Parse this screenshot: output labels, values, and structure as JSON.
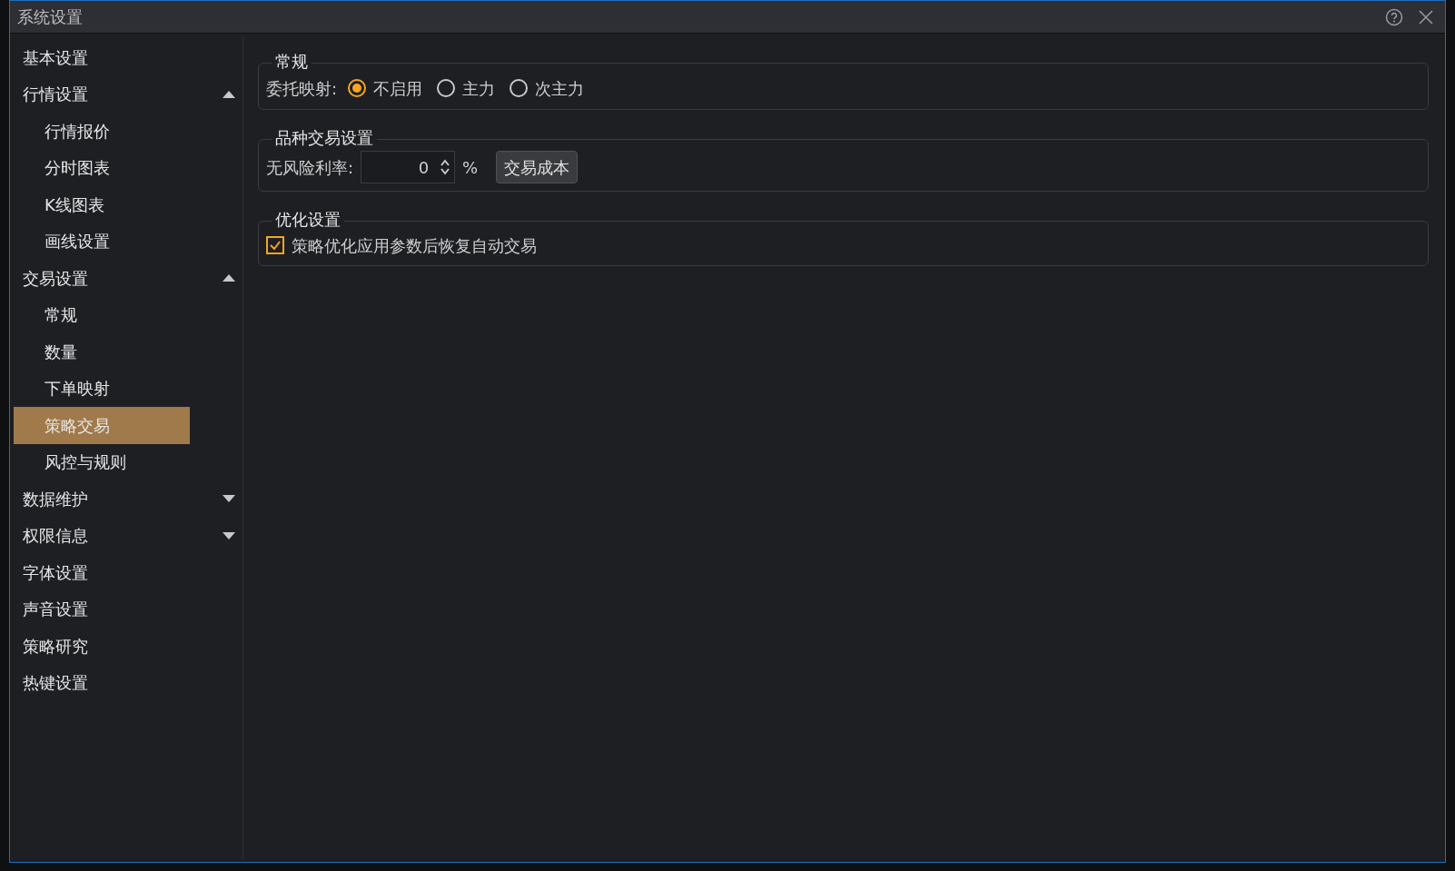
{
  "window": {
    "title": "系统设置"
  },
  "sidebar": {
    "items": [
      {
        "label": "基本设置",
        "selected": false
      },
      {
        "label": "行情设置",
        "selected": false,
        "expanded": true,
        "children": [
          {
            "label": "行情报价",
            "selected": false
          },
          {
            "label": "分时图表",
            "selected": false
          },
          {
            "label": "K线图表",
            "selected": false
          },
          {
            "label": "画线设置",
            "selected": false
          }
        ]
      },
      {
        "label": "交易设置",
        "selected": false,
        "expanded": true,
        "children": [
          {
            "label": "常规",
            "selected": false
          },
          {
            "label": "数量",
            "selected": false
          },
          {
            "label": "下单映射",
            "selected": false
          },
          {
            "label": "策略交易",
            "selected": true
          },
          {
            "label": "风控与规则",
            "selected": false
          }
        ]
      },
      {
        "label": "数据维护",
        "selected": false,
        "expanded": false
      },
      {
        "label": "权限信息",
        "selected": false,
        "expanded": false
      },
      {
        "label": "字体设置",
        "selected": false
      },
      {
        "label": "声音设置",
        "selected": false
      },
      {
        "label": "策略研究",
        "selected": false
      },
      {
        "label": "热键设置",
        "selected": false
      }
    ]
  },
  "general": {
    "title": "常规",
    "label": "委托映射:",
    "options": [
      {
        "label": "不启用",
        "selected": true
      },
      {
        "label": "主力",
        "selected": false
      },
      {
        "label": "次主力",
        "selected": false
      }
    ]
  },
  "instrument": {
    "title": "品种交易设置",
    "label": "无风险利率:",
    "value": "0",
    "unit": "%",
    "button": "交易成本"
  },
  "optimize": {
    "title": "优化设置",
    "checkbox": {
      "label": "策略优化应用参数后恢复自动交易",
      "checked": true
    }
  }
}
